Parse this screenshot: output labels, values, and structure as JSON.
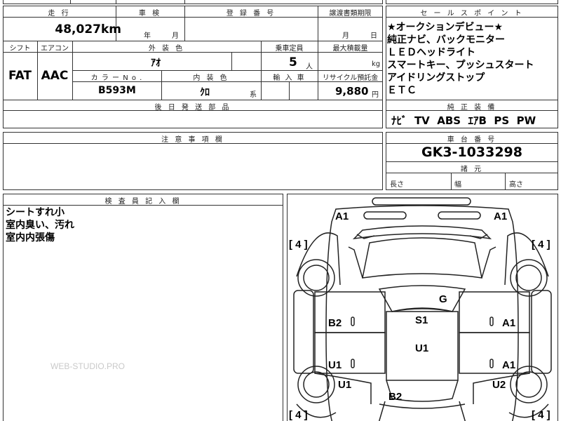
{
  "top_partial": "",
  "mileage": {
    "header": "走 行",
    "value": "48,027",
    "unit": "km"
  },
  "inspection": {
    "header": "車 検",
    "year_label": "年",
    "month_label": "月"
  },
  "registration": {
    "header": "登 録 番 号"
  },
  "transfer_deadline": {
    "header": "譲渡書類期限",
    "month_label": "月",
    "day_label": "日"
  },
  "shift": {
    "header": "シフト",
    "value": "FAT"
  },
  "aircon": {
    "header": "エアコン",
    "value": "AAC"
  },
  "exterior_color": {
    "header": "外 装 色",
    "value": "ｱｵ"
  },
  "capacity": {
    "header": "乗車定員",
    "value": "5",
    "unit": "人"
  },
  "max_load": {
    "header": "最大積載量",
    "unit": "kg"
  },
  "color_no": {
    "header": "カ ラ ー N o .",
    "value": "B593M"
  },
  "interior_color": {
    "header": "内 装 色",
    "value": "ｸﾛ",
    "suffix": "系"
  },
  "import": {
    "header": "輸 入 車"
  },
  "recycle": {
    "header": "リサイクル預託金",
    "value": "9,880",
    "unit": "円"
  },
  "later_parts": {
    "header": "後 日 発 送 部 品"
  },
  "notes": {
    "header": "注 意 事 項 欄"
  },
  "sales_points": {
    "header": "セ ー ル ス ポ イ ン ト",
    "lines": [
      "★オークションデビュー★",
      "純正ナビ、バックモニター",
      "ＬＥＤヘッドライト",
      "スマートキー、プッシュスタート",
      "アイドリングストップ",
      "ＥＴＣ"
    ]
  },
  "equipment": {
    "header": "純 正 装 備",
    "value": "ﾅﾋﾞ  TV  ABS  ｴｱB  PS  PW"
  },
  "chassis": {
    "header": "車 台 番 号",
    "value": "GK3-1033298"
  },
  "specs": {
    "header": "諸 元",
    "length": "長さ",
    "width": "幅",
    "height": "高さ"
  },
  "inspector": {
    "header": "検 査 員 記 入 欄",
    "lines": [
      "シートすれ小",
      "室内臭い、汚れ",
      "室内内張傷"
    ]
  },
  "diagram": {
    "labels": {
      "front_left": "A1",
      "front_right": "A1",
      "tire_fl": "[ 4 ]",
      "tire_fr": "[ 4 ]",
      "tire_rl": "[ 4 ]",
      "tire_rr": "[ 4 ]",
      "hood": "G",
      "roof_front": "S1",
      "roof_rear": "U1",
      "left_front_door": "B2",
      "right_front_door": "A1",
      "left_rear_door": "U1",
      "right_rear_door": "A1",
      "left_rear_fender": "U1",
      "right_rear_fender": "U2",
      "trunk": "B2"
    }
  },
  "watermark": "WEB-STUDIO.PRO"
}
